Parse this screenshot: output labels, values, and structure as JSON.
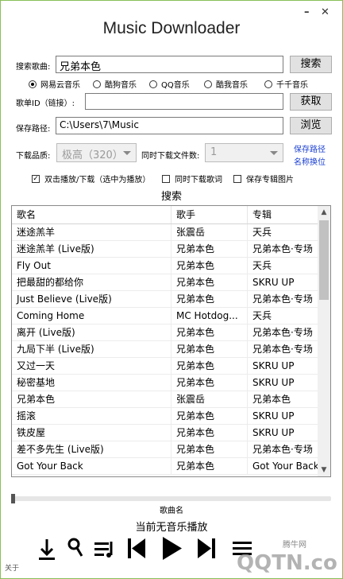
{
  "window": {
    "title": "Music Downloader",
    "minimize": "–",
    "close": "✕"
  },
  "search": {
    "label": "搜索歌曲:",
    "value": "兄弟本色",
    "button": "搜索"
  },
  "sources": [
    {
      "label": "网易云音乐",
      "selected": true
    },
    {
      "label": "酷狗音乐",
      "selected": false
    },
    {
      "label": "QQ音乐",
      "selected": false
    },
    {
      "label": "酷我音乐",
      "selected": false
    },
    {
      "label": "千千音乐",
      "selected": false
    }
  ],
  "playlist": {
    "label": "歌单ID（链接）:",
    "value": "",
    "button": "获取"
  },
  "save": {
    "label": "保存路径:",
    "value": "C:\\Users\\7\\Music",
    "button": "浏览"
  },
  "quality": {
    "label": "下载品质:",
    "value": "极高（320）"
  },
  "concurrent": {
    "label": "同时下载文件数:",
    "value": "1"
  },
  "links": {
    "save_path": "保存路径",
    "rename": "名称换位"
  },
  "options": [
    {
      "label": "双击播放/下载（选中为播放）",
      "checked": true
    },
    {
      "label": "同时下载歌词",
      "checked": false
    },
    {
      "label": "保存专辑图片",
      "checked": false
    }
  ],
  "results_label": "搜索",
  "table": {
    "headers": [
      "歌名",
      "歌手",
      "专辑"
    ],
    "rows": [
      [
        "迷途羔羊",
        "张震岳",
        "天兵"
      ],
      [
        "迷途羔羊 (Live版)",
        "兄弟本色",
        "兄弟本色·专场"
      ],
      [
        "Fly Out",
        "兄弟本色",
        "天兵"
      ],
      [
        "把最甜的都给你",
        "兄弟本色",
        "SKRU UP"
      ],
      [
        "Just Believe (Live版)",
        "兄弟本色",
        "兄弟本色·专场"
      ],
      [
        "Coming Home",
        "MC Hotdog...",
        "天兵"
      ],
      [
        "离开 (Live版)",
        "兄弟本色",
        "兄弟本色·专场"
      ],
      [
        "九局下半 (Live版)",
        "兄弟本色",
        "兄弟本色·专场"
      ],
      [
        "又过一天",
        "兄弟本色",
        "SKRU UP"
      ],
      [
        "秘密基地",
        "兄弟本色",
        "SKRU UP"
      ],
      [
        "兄弟本色",
        "张震岳",
        "兄弟本色"
      ],
      [
        "摇滚",
        "兄弟本色",
        "SKRU UP"
      ],
      [
        "铁皮屋",
        "兄弟本色",
        "SKRU UP"
      ],
      [
        "差不多先生 (Live版)",
        "兄弟本色",
        "兄弟本色·专场"
      ],
      [
        "Got Your Back",
        "兄弟本色",
        "Got Your Back"
      ]
    ]
  },
  "player": {
    "song_name": "歌曲名",
    "status": "当前无音乐播放",
    "progress": 0
  },
  "about": "关于",
  "watermark": {
    "brand": "QQTN.com",
    "subtitle": "腾牛网"
  }
}
